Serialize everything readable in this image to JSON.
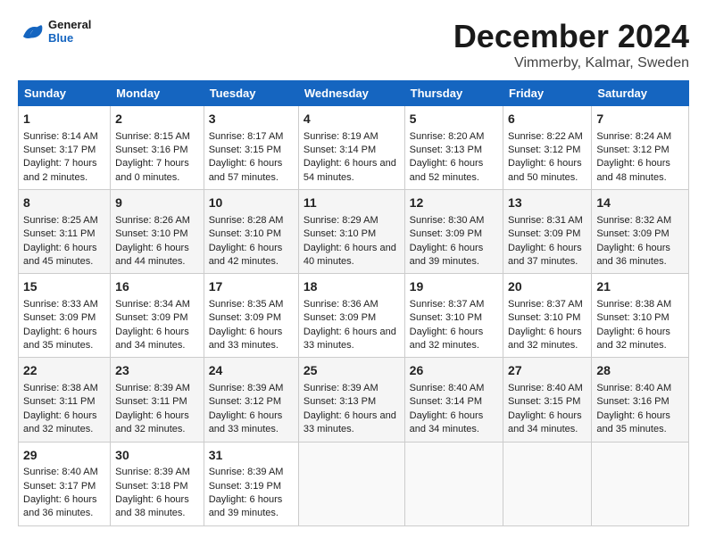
{
  "logo": {
    "text_general": "General",
    "text_blue": "Blue"
  },
  "title": "December 2024",
  "location": "Vimmerby, Kalmar, Sweden",
  "days_of_week": [
    "Sunday",
    "Monday",
    "Tuesday",
    "Wednesday",
    "Thursday",
    "Friday",
    "Saturday"
  ],
  "weeks": [
    [
      {
        "day": "1",
        "sunrise": "Sunrise: 8:14 AM",
        "sunset": "Sunset: 3:17 PM",
        "daylight": "Daylight: 7 hours and 2 minutes."
      },
      {
        "day": "2",
        "sunrise": "Sunrise: 8:15 AM",
        "sunset": "Sunset: 3:16 PM",
        "daylight": "Daylight: 7 hours and 0 minutes."
      },
      {
        "day": "3",
        "sunrise": "Sunrise: 8:17 AM",
        "sunset": "Sunset: 3:15 PM",
        "daylight": "Daylight: 6 hours and 57 minutes."
      },
      {
        "day": "4",
        "sunrise": "Sunrise: 8:19 AM",
        "sunset": "Sunset: 3:14 PM",
        "daylight": "Daylight: 6 hours and 54 minutes."
      },
      {
        "day": "5",
        "sunrise": "Sunrise: 8:20 AM",
        "sunset": "Sunset: 3:13 PM",
        "daylight": "Daylight: 6 hours and 52 minutes."
      },
      {
        "day": "6",
        "sunrise": "Sunrise: 8:22 AM",
        "sunset": "Sunset: 3:12 PM",
        "daylight": "Daylight: 6 hours and 50 minutes."
      },
      {
        "day": "7",
        "sunrise": "Sunrise: 8:24 AM",
        "sunset": "Sunset: 3:12 PM",
        "daylight": "Daylight: 6 hours and 48 minutes."
      }
    ],
    [
      {
        "day": "8",
        "sunrise": "Sunrise: 8:25 AM",
        "sunset": "Sunset: 3:11 PM",
        "daylight": "Daylight: 6 hours and 45 minutes."
      },
      {
        "day": "9",
        "sunrise": "Sunrise: 8:26 AM",
        "sunset": "Sunset: 3:10 PM",
        "daylight": "Daylight: 6 hours and 44 minutes."
      },
      {
        "day": "10",
        "sunrise": "Sunrise: 8:28 AM",
        "sunset": "Sunset: 3:10 PM",
        "daylight": "Daylight: 6 hours and 42 minutes."
      },
      {
        "day": "11",
        "sunrise": "Sunrise: 8:29 AM",
        "sunset": "Sunset: 3:10 PM",
        "daylight": "Daylight: 6 hours and 40 minutes."
      },
      {
        "day": "12",
        "sunrise": "Sunrise: 8:30 AM",
        "sunset": "Sunset: 3:09 PM",
        "daylight": "Daylight: 6 hours and 39 minutes."
      },
      {
        "day": "13",
        "sunrise": "Sunrise: 8:31 AM",
        "sunset": "Sunset: 3:09 PM",
        "daylight": "Daylight: 6 hours and 37 minutes."
      },
      {
        "day": "14",
        "sunrise": "Sunrise: 8:32 AM",
        "sunset": "Sunset: 3:09 PM",
        "daylight": "Daylight: 6 hours and 36 minutes."
      }
    ],
    [
      {
        "day": "15",
        "sunrise": "Sunrise: 8:33 AM",
        "sunset": "Sunset: 3:09 PM",
        "daylight": "Daylight: 6 hours and 35 minutes."
      },
      {
        "day": "16",
        "sunrise": "Sunrise: 8:34 AM",
        "sunset": "Sunset: 3:09 PM",
        "daylight": "Daylight: 6 hours and 34 minutes."
      },
      {
        "day": "17",
        "sunrise": "Sunrise: 8:35 AM",
        "sunset": "Sunset: 3:09 PM",
        "daylight": "Daylight: 6 hours and 33 minutes."
      },
      {
        "day": "18",
        "sunrise": "Sunrise: 8:36 AM",
        "sunset": "Sunset: 3:09 PM",
        "daylight": "Daylight: 6 hours and 33 minutes."
      },
      {
        "day": "19",
        "sunrise": "Sunrise: 8:37 AM",
        "sunset": "Sunset: 3:10 PM",
        "daylight": "Daylight: 6 hours and 32 minutes."
      },
      {
        "day": "20",
        "sunrise": "Sunrise: 8:37 AM",
        "sunset": "Sunset: 3:10 PM",
        "daylight": "Daylight: 6 hours and 32 minutes."
      },
      {
        "day": "21",
        "sunrise": "Sunrise: 8:38 AM",
        "sunset": "Sunset: 3:10 PM",
        "daylight": "Daylight: 6 hours and 32 minutes."
      }
    ],
    [
      {
        "day": "22",
        "sunrise": "Sunrise: 8:38 AM",
        "sunset": "Sunset: 3:11 PM",
        "daylight": "Daylight: 6 hours and 32 minutes."
      },
      {
        "day": "23",
        "sunrise": "Sunrise: 8:39 AM",
        "sunset": "Sunset: 3:11 PM",
        "daylight": "Daylight: 6 hours and 32 minutes."
      },
      {
        "day": "24",
        "sunrise": "Sunrise: 8:39 AM",
        "sunset": "Sunset: 3:12 PM",
        "daylight": "Daylight: 6 hours and 33 minutes."
      },
      {
        "day": "25",
        "sunrise": "Sunrise: 8:39 AM",
        "sunset": "Sunset: 3:13 PM",
        "daylight": "Daylight: 6 hours and 33 minutes."
      },
      {
        "day": "26",
        "sunrise": "Sunrise: 8:40 AM",
        "sunset": "Sunset: 3:14 PM",
        "daylight": "Daylight: 6 hours and 34 minutes."
      },
      {
        "day": "27",
        "sunrise": "Sunrise: 8:40 AM",
        "sunset": "Sunset: 3:15 PM",
        "daylight": "Daylight: 6 hours and 34 minutes."
      },
      {
        "day": "28",
        "sunrise": "Sunrise: 8:40 AM",
        "sunset": "Sunset: 3:16 PM",
        "daylight": "Daylight: 6 hours and 35 minutes."
      }
    ],
    [
      {
        "day": "29",
        "sunrise": "Sunrise: 8:40 AM",
        "sunset": "Sunset: 3:17 PM",
        "daylight": "Daylight: 6 hours and 36 minutes."
      },
      {
        "day": "30",
        "sunrise": "Sunrise: 8:39 AM",
        "sunset": "Sunset: 3:18 PM",
        "daylight": "Daylight: 6 hours and 38 minutes."
      },
      {
        "day": "31",
        "sunrise": "Sunrise: 8:39 AM",
        "sunset": "Sunset: 3:19 PM",
        "daylight": "Daylight: 6 hours and 39 minutes."
      },
      null,
      null,
      null,
      null
    ]
  ]
}
